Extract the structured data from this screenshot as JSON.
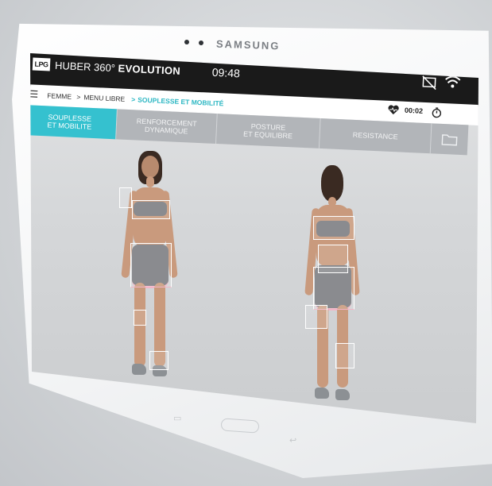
{
  "device": {
    "brand": "SAMSUNG"
  },
  "app": {
    "logo": "LPG",
    "title_light": "HUBER 360°",
    "title_bold": "EVOLUTION",
    "time": "09:48"
  },
  "status_icons": {
    "cast": "cast-off-icon",
    "wifi": "wifi-icon"
  },
  "breadcrumb": {
    "menu_icon": "hamburger-menu-icon",
    "items": [
      "FEMME",
      ">",
      "MENU LIBRE",
      ">",
      "SOUPLESSE ET MOBILITÉ"
    ]
  },
  "session": {
    "timer": "00:02",
    "heart_icon": "heart-rate-icon",
    "stopwatch_icon": "stopwatch-icon"
  },
  "tabs": [
    {
      "label": "SOUPLESSE\nET MOBILITE",
      "active": true
    },
    {
      "label": "RENFORCEMENT\nDYNAMIQUE",
      "active": false
    },
    {
      "label": "POSTURE\nET EQUILIBRE",
      "active": false
    },
    {
      "label": "RESISTANCE",
      "active": false
    }
  ],
  "folder_icon": "folder-icon",
  "colors": {
    "accent": "#35c1cf",
    "topbar": "#1a1a1a",
    "tab_inactive": "#b2b5b9",
    "breadcrumb_active": "#2fb8c4"
  }
}
